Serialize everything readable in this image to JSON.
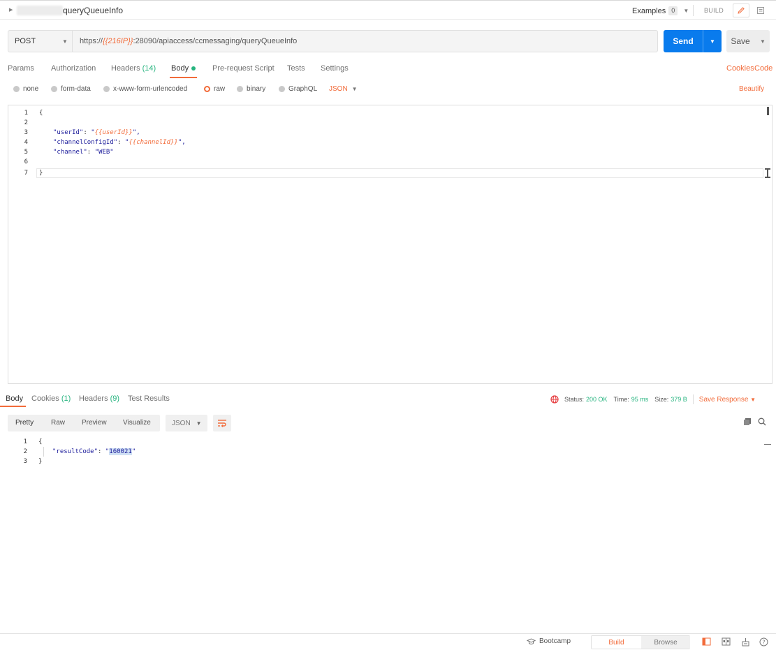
{
  "header": {
    "request_name": "queryQueueInfo",
    "examples_label": "Examples",
    "examples_count": "0",
    "build_label": "BUILD"
  },
  "request": {
    "method": "POST",
    "url_prefix": "https://",
    "url_variable": "{{216IP}}",
    "url_suffix": ":28090/apiaccess/ccmessaging/queryQueueInfo",
    "send_label": "Send",
    "save_label": "Save"
  },
  "request_tabs": {
    "params": "Params",
    "authorization": "Authorization",
    "headers": "Headers",
    "headers_count": "(14)",
    "body": "Body",
    "pre_request_script": "Pre-request Script",
    "tests": "Tests",
    "settings": "Settings",
    "cookies_link": "Cookies",
    "code_link": "Code"
  },
  "body_modes": {
    "none": "none",
    "form_data": "form-data",
    "urlencoded": "x-www-form-urlencoded",
    "raw": "raw",
    "binary": "binary",
    "graphql": "GraphQL",
    "format": "JSON",
    "beautify": "Beautify"
  },
  "editor": {
    "line_numbers": [
      "1",
      "2",
      "3",
      "4",
      "5",
      "6",
      "7"
    ],
    "open_brace": "{",
    "close_brace": "}",
    "key1": "\"userId\"",
    "val1_q": "\"",
    "val1_var": "{{userId}}",
    "val1_end": "\",",
    "key2": "\"channelConfigId\"",
    "val2_var": "{{channelId}}",
    "val2_end": "\",",
    "key3": "\"channel\"",
    "val3": "\"WEB\"",
    "colon": ": "
  },
  "response": {
    "tabs": {
      "body": "Body",
      "cookies": "Cookies",
      "cookies_count": "(1)",
      "headers": "Headers",
      "headers_count": "(9)",
      "test_results": "Test Results"
    },
    "status_label": "Status:",
    "status_value": "200 OK",
    "time_label": "Time:",
    "time_value": "95 ms",
    "size_label": "Size:",
    "size_value": "379 B",
    "save_response": "Save Response",
    "views": {
      "pretty": "Pretty",
      "raw": "Raw",
      "preview": "Preview",
      "visualize": "Visualize"
    },
    "format": "JSON",
    "line_numbers": [
      "1",
      "2",
      "3"
    ],
    "open_brace": "{",
    "close_brace": "}",
    "key": "\"resultCode\"",
    "colon": ": ",
    "quote": "\"",
    "value": "160021"
  },
  "footer": {
    "bootcamp": "Bootcamp",
    "build": "Build",
    "browse": "Browse"
  },
  "colors": {
    "accent": "#f26b3a",
    "primary": "#097bed",
    "success": "#26b47f"
  }
}
